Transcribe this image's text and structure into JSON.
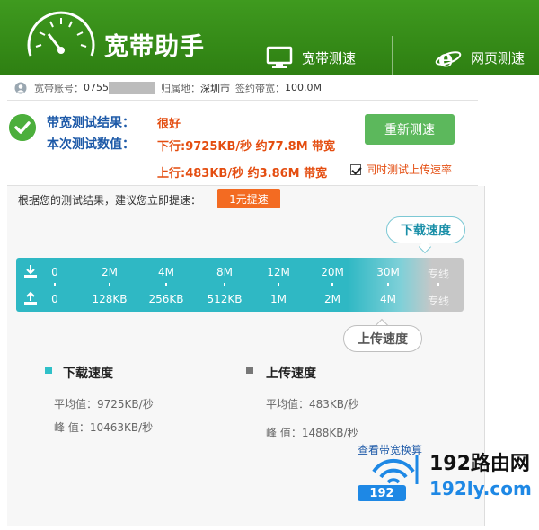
{
  "header": {
    "title": "宽带助手",
    "nav": [
      {
        "label": "宽带测速",
        "icon": "monitor-icon"
      },
      {
        "label": "网页测速",
        "icon": "ie-browser-icon"
      }
    ]
  },
  "account": {
    "account_label": "宽带账号：",
    "account_value": "0755",
    "location_label": "归属地：",
    "location_value": "深圳市",
    "bandwidth_label": "签约带宽：",
    "bandwidth_value": "100.0M"
  },
  "result": {
    "label_result": "带宽测试结果：",
    "value_result": "很好",
    "label_values": "本次测试数值：",
    "download_line": "下行:9725KB/秒 约77.8M 带宽",
    "upload_line": "上行:483KB/秒 约3.86M 带宽",
    "retest_button": "重新测速",
    "upload_checkbox_label": "同时测试上传速率",
    "upload_checkbox_checked": true
  },
  "suggestion": {
    "text": "根据您的测试结果，建议您立即提速：",
    "button": "1元提速"
  },
  "speed_bar": {
    "download_bubble": "下载速度",
    "upload_bubble": "上传速度",
    "download_ticks": [
      "0",
      "2M",
      "4M",
      "8M",
      "12M",
      "20M",
      "30M",
      "专线"
    ],
    "upload_ticks": [
      "0",
      "128KB",
      "256KB",
      "512KB",
      "1M",
      "2M",
      "4M",
      "专线"
    ],
    "download_level_fraction": 0.82,
    "colors": {
      "fill": "#2fb8c4",
      "empty": "#c7c7c7"
    }
  },
  "stats": {
    "download": {
      "title": "下载速度",
      "avg_label": "平均值：",
      "avg_value": "9725KB/秒",
      "peak_label": "峰  值：",
      "peak_value": "10463KB/秒",
      "color": "#2fc0c8"
    },
    "upload": {
      "title": "上传速度",
      "avg_label": "平均值：",
      "avg_value": "483KB/秒",
      "peak_label": "峰  值：",
      "peak_value": "1488KB/秒",
      "color": "#777777"
    }
  },
  "link": "查看带宽换算",
  "watermark": {
    "name": "192路由网",
    "num": "192",
    "url": "192ly.com"
  }
}
